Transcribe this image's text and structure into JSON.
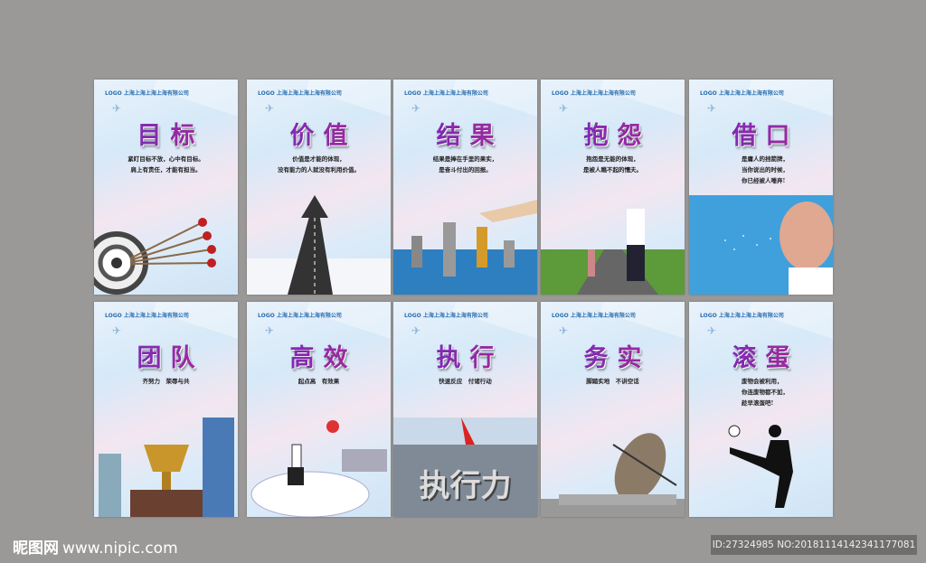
{
  "posters": [
    {
      "logo": "LOGO 上海上海上海上海有限公司",
      "title": "目标",
      "lines": [
        "紧盯目标不放，心中有目标。",
        "肩上有责任，才能有担当。"
      ],
      "art": "target-arrows-icon"
    },
    {
      "logo": "LOGO 上海上海上海上海有限公司",
      "title": "价值",
      "lines": [
        "价值是才能的体现，",
        "没有能力的人就没有利用价值。"
      ],
      "art": "arrow-road-icon"
    },
    {
      "logo": "LOGO 上海上海上海上海有限公司",
      "title": "结果",
      "lines": [
        "结果是捧在手里的果实，",
        "是奋斗付出的回报。"
      ],
      "art": "chess-icon"
    },
    {
      "logo": "LOGO 上海上海上海上海有限公司",
      "title": "抱怨",
      "lines": [
        "抱怨是无能的体现，",
        "是被人瞧不起的懦夫。"
      ],
      "art": "man-shouting-icon"
    },
    {
      "logo": "LOGO 上海上海上海上海有限公司",
      "title": "借口",
      "lines": [
        "是庸人的挡箭牌，",
        "当你说出的时候，",
        "你已经被人唾弃!"
      ],
      "art": "screaming-head-icon"
    },
    {
      "logo": "LOGO 上海上海上海上海有限公司",
      "title": "团队",
      "lines": [
        "齐努力　荣辱与共"
      ],
      "art": "trophy-icon"
    },
    {
      "logo": "LOGO 上海上海上海上海有限公司",
      "title": "高效",
      "lines": [
        "起点高　有效果"
      ],
      "art": "clock-runner-icon"
    },
    {
      "logo": "LOGO 上海上海上海上海有限公司",
      "title": "执行",
      "lines": [
        "快速反应　付诸行动"
      ],
      "art": "execution-icon",
      "art_text": "执行力"
    },
    {
      "logo": "LOGO 上海上海上海上海有限公司",
      "title": "务实",
      "lines": [
        "脚踏实地　不讲空话"
      ],
      "art": "sundial-icon"
    },
    {
      "logo": "LOGO 上海上海上海上海有限公司",
      "title": "滚蛋",
      "lines": [
        "废物会被利用，",
        "你连废物都不如，",
        "趁早滚蛋吧!"
      ],
      "art": "kicking-man-icon"
    }
  ],
  "watermark": {
    "brand": "昵图网",
    "url": "www.nipic.com"
  },
  "id_label": "ID:27324985 NO:20181114142341177081"
}
